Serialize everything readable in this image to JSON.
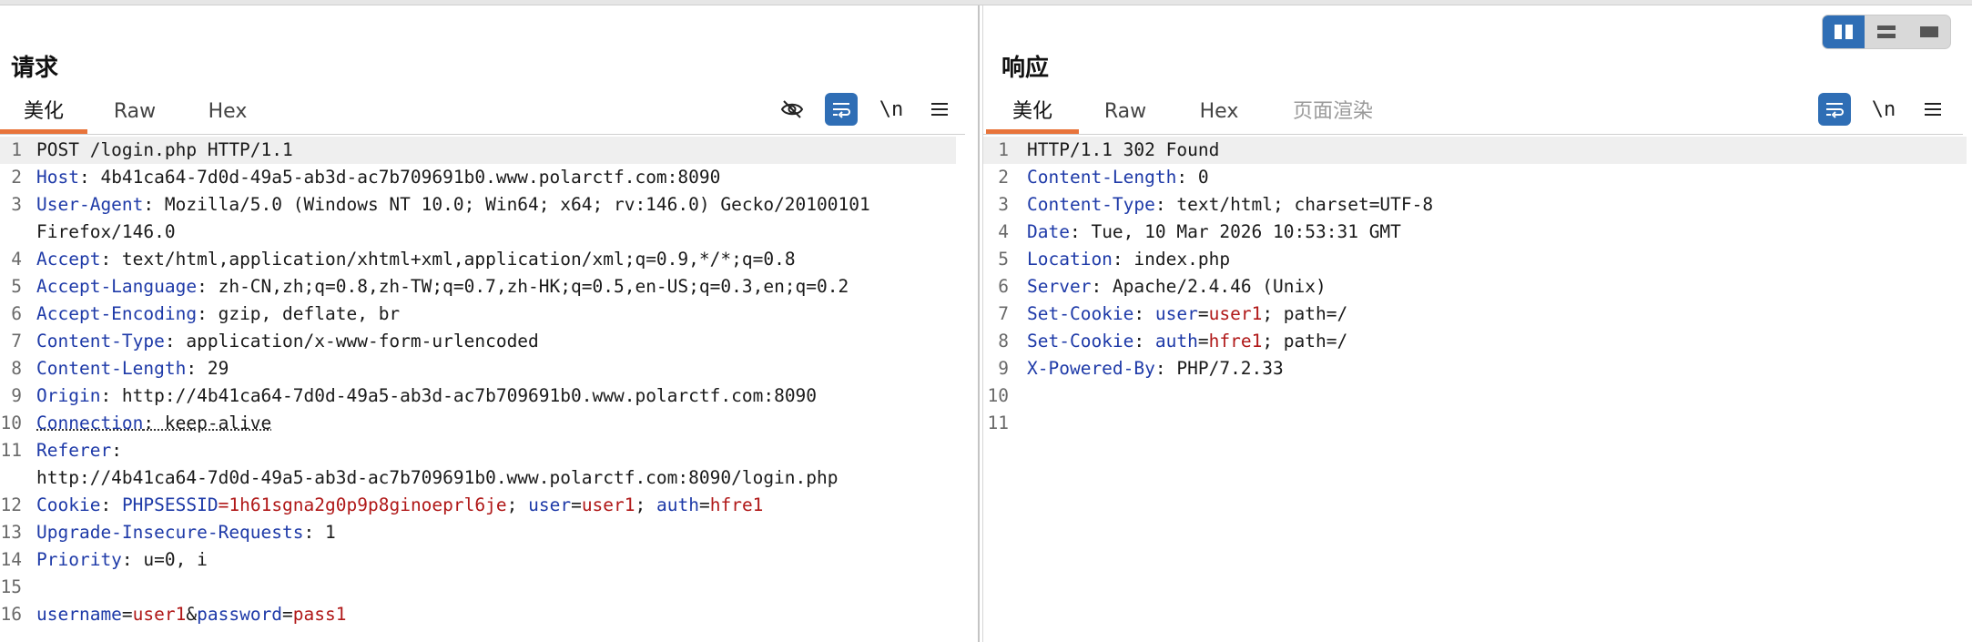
{
  "layout_controls": {
    "items": [
      {
        "name": "split-horizontal",
        "active": true
      },
      {
        "name": "split-vertical",
        "active": false
      },
      {
        "name": "single-view",
        "active": false
      }
    ]
  },
  "request": {
    "title": "请求",
    "tabs": [
      "美化",
      "Raw",
      "Hex"
    ],
    "active_tab": "美化",
    "tools": {
      "hide": "eye-slash-icon",
      "wrap": "wrap-lines-icon",
      "newline_label": "\\n",
      "menu": "hamburger-menu-icon"
    },
    "lines": [
      {
        "n": "1",
        "parts": [
          {
            "t": "POST /login.php HTTP/1.1"
          }
        ]
      },
      {
        "n": "2",
        "parts": [
          {
            "t": "Host",
            "k": 1
          },
          {
            "t": ": 4b41ca64-7d0d-49a5-ab3d-ac7b709691b0.www.polarctf.com:8090"
          }
        ]
      },
      {
        "n": "3",
        "parts": [
          {
            "t": "User-Agent",
            "k": 1
          },
          {
            "t": ": Mozilla/5.0 (Windows NT 10.0; Win64; x64; rv:146.0) Gecko/20100101"
          }
        ]
      },
      {
        "n": "",
        "parts": [
          {
            "t": "Firefox/146.0"
          }
        ]
      },
      {
        "n": "4",
        "parts": [
          {
            "t": "Accept",
            "k": 1
          },
          {
            "t": ": text/html,application/xhtml+xml,application/xml;q=0.9,*/*;q=0.8"
          }
        ]
      },
      {
        "n": "5",
        "parts": [
          {
            "t": "Accept-Language",
            "k": 1
          },
          {
            "t": ": zh-CN,zh;q=0.8,zh-TW;q=0.7,zh-HK;q=0.5,en-US;q=0.3,en;q=0.2"
          }
        ]
      },
      {
        "n": "6",
        "parts": [
          {
            "t": "Accept-Encoding",
            "k": 1
          },
          {
            "t": ": gzip, deflate, br"
          }
        ]
      },
      {
        "n": "7",
        "parts": [
          {
            "t": "Content-Type",
            "k": 1
          },
          {
            "t": ": application/x-www-form-urlencoded"
          }
        ]
      },
      {
        "n": "8",
        "parts": [
          {
            "t": "Content-Length",
            "k": 1
          },
          {
            "t": ": 29"
          }
        ]
      },
      {
        "n": "9",
        "parts": [
          {
            "t": "Origin",
            "k": 1
          },
          {
            "t": ": http://4b41ca64-7d0d-49a5-ab3d-ac7b709691b0.www.polarctf.com:8090"
          }
        ]
      },
      {
        "n": "10",
        "parts": [
          {
            "t": "Connection",
            "k": 1,
            "w": 1
          },
          {
            "t": ": keep-alive",
            "w": 1
          }
        ]
      },
      {
        "n": "11",
        "parts": [
          {
            "t": "Referer",
            "k": 1
          },
          {
            "t": ":"
          }
        ]
      },
      {
        "n": "",
        "parts": [
          {
            "t": "http://4b41ca64-7d0d-49a5-ab3d-ac7b709691b0.www.polarctf.com:8090/login.php"
          }
        ]
      },
      {
        "n": "12",
        "parts": [
          {
            "t": "Cookie",
            "k": 1
          },
          {
            "t": ": "
          },
          {
            "t": "PHPSESSID",
            "k": 1
          },
          {
            "t": "=",
            "v": 1
          },
          {
            "t": "1h61sgna2g0p9p8ginoeprl6je",
            "v": 1
          },
          {
            "t": "; "
          },
          {
            "t": "user",
            "k": 1
          },
          {
            "t": "="
          },
          {
            "t": "user1",
            "v": 1
          },
          {
            "t": "; "
          },
          {
            "t": "auth",
            "k": 1
          },
          {
            "t": "="
          },
          {
            "t": "hfre1",
            "v": 1
          }
        ]
      },
      {
        "n": "13",
        "parts": [
          {
            "t": "Upgrade-Insecure-Requests",
            "k": 1
          },
          {
            "t": ": 1"
          }
        ]
      },
      {
        "n": "14",
        "parts": [
          {
            "t": "Priority",
            "k": 1
          },
          {
            "t": ": u=0, i"
          }
        ]
      },
      {
        "n": "15",
        "parts": [
          {
            "t": ""
          }
        ]
      },
      {
        "n": "16",
        "parts": [
          {
            "t": "username",
            "k": 1
          },
          {
            "t": "="
          },
          {
            "t": "user1",
            "v": 1
          },
          {
            "t": "&"
          },
          {
            "t": "password",
            "k": 1
          },
          {
            "t": "="
          },
          {
            "t": "pass1",
            "v": 1
          }
        ]
      }
    ]
  },
  "response": {
    "title": "响应",
    "tabs": [
      "美化",
      "Raw",
      "Hex",
      "页面渲染"
    ],
    "active_tab": "美化",
    "disabled_tab": "页面渲染",
    "tools": {
      "wrap": "wrap-lines-icon",
      "newline_label": "\\n",
      "menu": "hamburger-menu-icon"
    },
    "lines": [
      {
        "n": "1",
        "parts": [
          {
            "t": "HTTP/1.1 302 Found"
          }
        ]
      },
      {
        "n": "2",
        "parts": [
          {
            "t": "Content-Length",
            "k": 1
          },
          {
            "t": ": 0"
          }
        ]
      },
      {
        "n": "3",
        "parts": [
          {
            "t": "Content-Type",
            "k": 1
          },
          {
            "t": ": text/html; charset=UTF-8"
          }
        ]
      },
      {
        "n": "4",
        "parts": [
          {
            "t": "Date",
            "k": 1
          },
          {
            "t": ": Tue, 10 Mar 2026 10:53:31 GMT"
          }
        ]
      },
      {
        "n": "5",
        "parts": [
          {
            "t": "Location",
            "k": 1
          },
          {
            "t": ": index.php"
          }
        ]
      },
      {
        "n": "6",
        "parts": [
          {
            "t": "Server",
            "k": 1
          },
          {
            "t": ": Apache/2.4.46 (Unix)"
          }
        ]
      },
      {
        "n": "7",
        "parts": [
          {
            "t": "Set-Cookie",
            "k": 1
          },
          {
            "t": ": "
          },
          {
            "t": "user",
            "k": 1
          },
          {
            "t": "="
          },
          {
            "t": "user1",
            "v": 1
          },
          {
            "t": "; path=/"
          }
        ]
      },
      {
        "n": "8",
        "parts": [
          {
            "t": "Set-Cookie",
            "k": 1
          },
          {
            "t": ": "
          },
          {
            "t": "auth",
            "k": 1
          },
          {
            "t": "="
          },
          {
            "t": "hfre1",
            "v": 1
          },
          {
            "t": "; path=/"
          }
        ]
      },
      {
        "n": "9",
        "parts": [
          {
            "t": "X-Powered-By",
            "k": 1
          },
          {
            "t": ": PHP/7.2.33"
          }
        ]
      },
      {
        "n": "10",
        "parts": [
          {
            "t": ""
          }
        ]
      },
      {
        "n": "11",
        "parts": [
          {
            "t": ""
          }
        ]
      }
    ]
  },
  "colors": {
    "accent": "#2f6eb5",
    "tab_underline": "#e8743b",
    "header_name": "#1e3aa8",
    "value": "#b01818"
  }
}
